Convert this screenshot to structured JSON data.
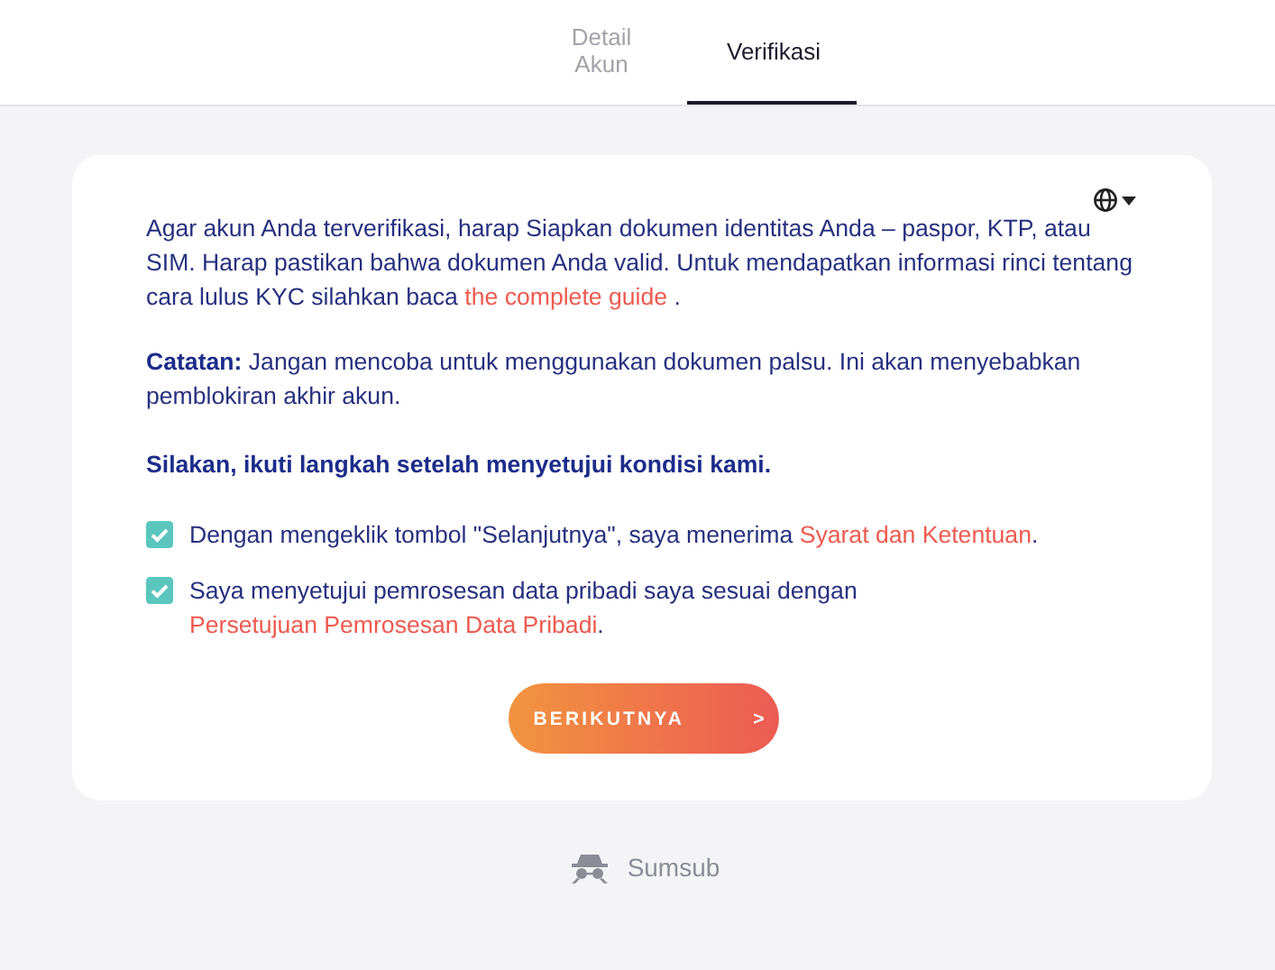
{
  "tabs": [
    {
      "label": "Detail Akun",
      "selected": false
    },
    {
      "label": "Verifikasi",
      "selected": true
    }
  ],
  "intro": {
    "text": "Agar akun Anda terverifikasi, harap Siapkan dokumen identitas Anda – paspor, KTP, atau SIM. Harap pastikan bahwa dokumen Anda valid. Untuk mendapatkan informasi rinci tentang cara lulus KYC silahkan baca ",
    "link": "the complete guide",
    "after": " ."
  },
  "note": "**Catatan:** Jangan mencoba untuk menggunakan dokumen palsu. Ini akan menyebabkan pemblokiran akhir akun.",
  "instruction": "Silakan, ikuti langkah setelah menyetujui kondisi kami.",
  "agreements": [
    {
      "text": "Dengan mengeklik tombol \"Selanjutnya\", saya menerima ",
      "link": "Syarat dan Ketentuan",
      "after": ".",
      "checked": true
    },
    {
      "text": "Saya menyetujui pemrosesan data pribadi saya sesuai dengan ",
      "link": "Persetujuan Pemrosesan Data Pribadi",
      "after": ".",
      "checked": true
    }
  ],
  "next_button": {
    "label": "BERIKUTNYA",
    "arrow": ">"
  },
  "footer": {
    "brand": "Sumsub"
  }
}
